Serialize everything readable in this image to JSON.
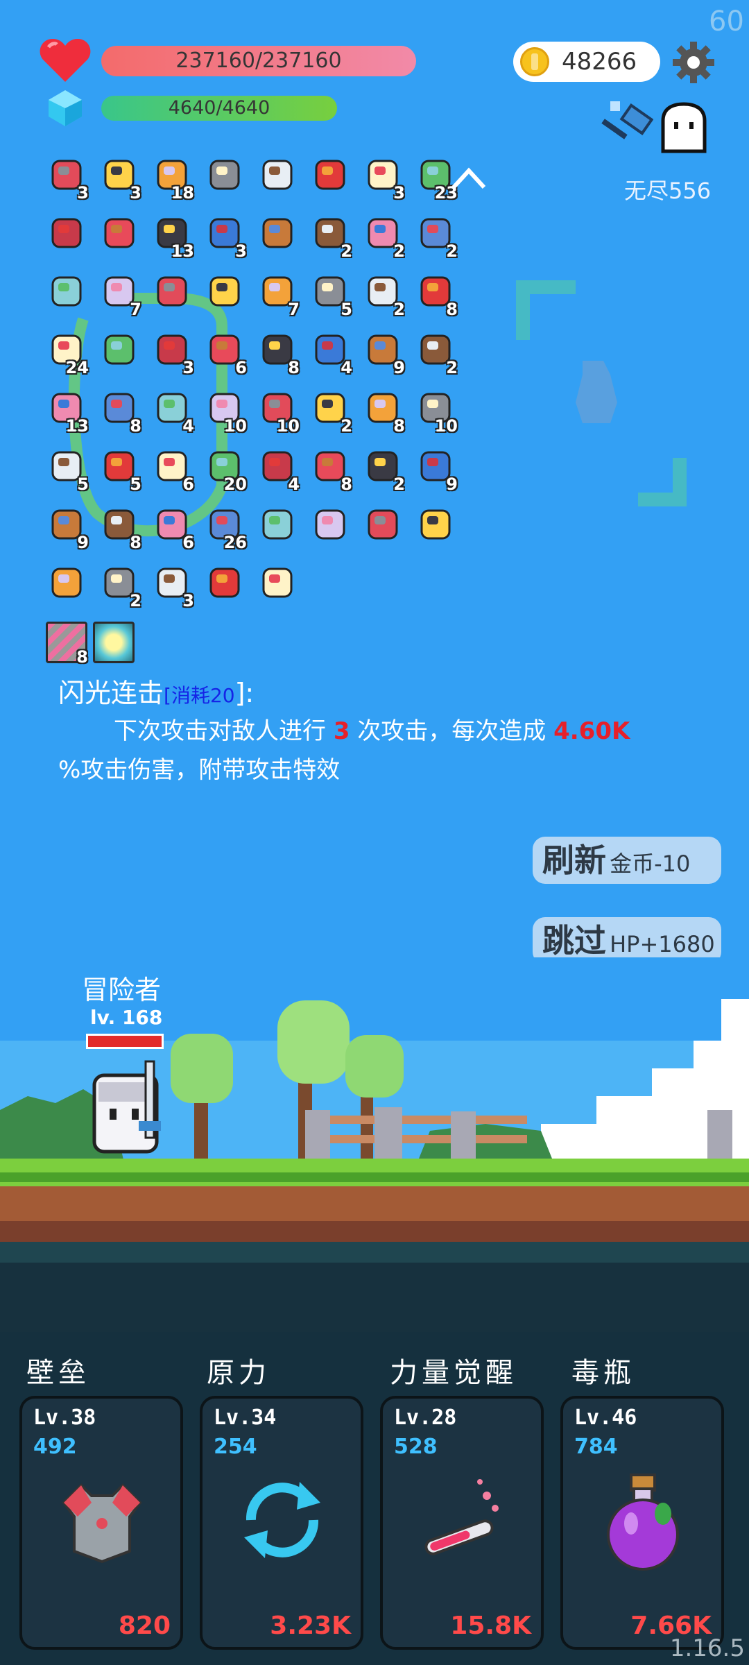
{
  "fps": "60",
  "version": "1.16.5",
  "hud": {
    "hp_text": "237160/237160",
    "mp_text": "4640/4640",
    "coins": "48266",
    "endless_label": "无尽556"
  },
  "item_rows": [
    [
      {
        "icon": "jam-jar-icon",
        "count": "3"
      },
      {
        "icon": "flower-icon",
        "count": "3"
      },
      {
        "icon": "crown-icon",
        "count": "18"
      },
      {
        "icon": "mortar-icon",
        "count": ""
      },
      {
        "icon": "sword-icon",
        "count": ""
      },
      {
        "icon": "sock-icon",
        "count": ""
      },
      {
        "icon": "fried-egg-icon",
        "count": "3"
      },
      {
        "icon": "money-heart-icon",
        "count": "23"
      }
    ],
    [
      {
        "icon": "magnet-icon",
        "count": ""
      },
      {
        "icon": "watermelon-icon",
        "count": ""
      },
      {
        "icon": "bat-icon",
        "count": "13"
      },
      {
        "icon": "book-icon",
        "count": "3"
      },
      {
        "icon": "mushroom-icon",
        "count": ""
      },
      {
        "icon": "perfume-icon",
        "count": "2"
      },
      {
        "icon": "shield-icon",
        "count": "2"
      },
      {
        "icon": "coconut-icon",
        "count": "2"
      }
    ],
    [
      {
        "icon": "pill-icon",
        "count": ""
      },
      {
        "icon": "star-shield-icon",
        "count": "7"
      },
      {
        "icon": "skull-book-icon",
        "count": ""
      },
      {
        "icon": "helmet-icon",
        "count": ""
      },
      {
        "icon": "mace-icon",
        "count": "7"
      },
      {
        "icon": "target-icon",
        "count": "5"
      },
      {
        "icon": "round-shield-icon",
        "count": "2"
      },
      {
        "icon": "compass-icon",
        "count": "8"
      }
    ],
    [
      {
        "icon": "lightbulb-icon",
        "count": "24"
      },
      {
        "icon": "green-card-icon",
        "count": ""
      },
      {
        "icon": "star-box-icon",
        "count": "3"
      },
      {
        "icon": "slime-icon",
        "count": "6"
      },
      {
        "icon": "crystal-ball-icon",
        "count": "8"
      },
      {
        "icon": "tombstone-icon",
        "count": "4"
      },
      {
        "icon": "hook-icon",
        "count": "9"
      },
      {
        "icon": "potion-flask-icon",
        "count": "2"
      }
    ],
    [
      {
        "icon": "star-card-icon",
        "count": "13"
      },
      {
        "icon": "ice-cream-icon",
        "count": "8"
      },
      {
        "icon": "gift-icon",
        "count": "4"
      },
      {
        "icon": "dice-icon",
        "count": "10"
      },
      {
        "icon": "red-mushroom-icon",
        "count": "10"
      },
      {
        "icon": "magic-wand-icon",
        "count": "2"
      },
      {
        "icon": "playing-cards-icon",
        "count": "8"
      },
      {
        "icon": "axe-icon",
        "count": "10"
      }
    ],
    [
      {
        "icon": "ring-icon",
        "count": "5"
      },
      {
        "icon": "map-icon",
        "count": "5"
      },
      {
        "icon": "noose-icon",
        "count": "6"
      },
      {
        "icon": "broad-sword-icon",
        "count": "20"
      },
      {
        "icon": "fist-icon",
        "count": "4"
      },
      {
        "icon": "lime-icon",
        "count": "8"
      },
      {
        "icon": "clipboard-icon",
        "count": "2"
      },
      {
        "icon": "cake-flag-icon",
        "count": "9"
      }
    ],
    [
      {
        "icon": "grenade-icon",
        "count": "9"
      },
      {
        "icon": "meteor-icon",
        "count": "8"
      },
      {
        "icon": "bow-icon",
        "count": "6"
      },
      {
        "icon": "coin-stack-icon",
        "count": "26"
      },
      {
        "icon": "ghost-icon",
        "count": ""
      },
      {
        "icon": "disc-icon",
        "count": ""
      },
      {
        "icon": "chat-bubble-icon",
        "count": ""
      },
      {
        "icon": "gem-icon",
        "count": ""
      }
    ],
    [
      {
        "icon": "cloud-icon",
        "count": ""
      },
      {
        "icon": "cauldron-icon",
        "count": "2"
      },
      {
        "icon": "bulb-icon",
        "count": "3"
      },
      {
        "icon": "speech-bubble-icon",
        "count": ""
      },
      {
        "icon": "sunflower-icon",
        "count": ""
      }
    ]
  ],
  "skills": [
    {
      "icon": "stripes-card-icon",
      "count": "8"
    },
    {
      "icon": "sparkle-card-icon",
      "count": ""
    }
  ],
  "description": {
    "title": "闪光连击",
    "cost_prefix": "[",
    "cost": "消耗20",
    "cost_suffix": "]:",
    "line1_a": "下次攻击对敌人进行 ",
    "hits": "3",
    "line1_b": " 次攻击，每次造成 ",
    "damage": "4.60K",
    "line2": "%攻击伤害，附带攻击特效"
  },
  "buttons": {
    "refresh_label": "刷新",
    "refresh_cost": "金币-10",
    "skip_label": "跳过",
    "skip_reward": "HP+1680"
  },
  "player": {
    "name": "冒险者",
    "level": "lv. 168",
    "hp_fraction": 1.0
  },
  "cards": [
    {
      "title": "壁垒",
      "level": "Lv.38",
      "value": "492",
      "power": "820",
      "icon": "armor-icon"
    },
    {
      "title": "原力",
      "level": "Lv.34",
      "value": "254",
      "power": "3.23K",
      "icon": "refresh-cycle-icon"
    },
    {
      "title": "力量觉醒",
      "level": "Lv.28",
      "value": "528",
      "power": "15.8K",
      "icon": "test-tube-icon"
    },
    {
      "title": "毒瓶",
      "level": "Lv.46",
      "value": "784",
      "power": "7.66K",
      "icon": "poison-flask-icon"
    }
  ],
  "colors": {
    "sky": "#33a0f4",
    "hp_bar": "#f36b6b",
    "mp_bar": "#39c68a",
    "damage_red": "#e6202a",
    "panel": "#15303e",
    "card_value": "#3fc0ff",
    "card_power": "#ff4a4a"
  }
}
